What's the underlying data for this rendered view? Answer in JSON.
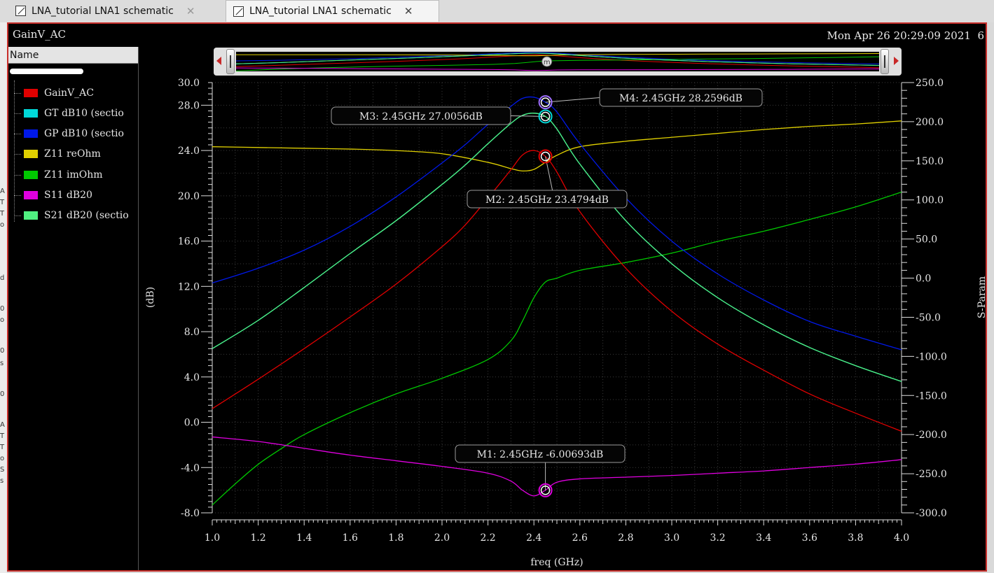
{
  "tabs": [
    {
      "label": "LNA_tutorial LNA1 schematic"
    },
    {
      "label": "LNA_tutorial LNA1 schematic"
    }
  ],
  "window": {
    "plot_title": "GainV_AC",
    "datetime": "Mon Apr 26 20:29:09 2021",
    "subwindow_number": "6"
  },
  "legend": {
    "header": "Name",
    "items": [
      {
        "label": "GainV_AC",
        "color": "#e00000"
      },
      {
        "label": "GT dB10 (sectio",
        "color": "#00d8d8"
      },
      {
        "label": "GP dB10 (sectio",
        "color": "#0018e8"
      },
      {
        "label": "Z11 reOhm",
        "color": "#e0d000"
      },
      {
        "label": "Z11 imOhm",
        "color": "#00c800"
      },
      {
        "label": "S11 dB20",
        "color": "#e000e0"
      },
      {
        "label": "S21 dB20 (sectio",
        "color": "#50f080"
      }
    ]
  },
  "left_edge_glyphs": [
    "A",
    "T",
    "T",
    "o",
    "d",
    "0",
    "o",
    "0",
    "s",
    "0",
    "A",
    "T",
    "T",
    "o",
    "S",
    "s"
  ],
  "overview": {
    "marker_glyph": "m",
    "left_glyph": "ll",
    "right_glyph": "ll"
  },
  "chart_data": {
    "type": "line",
    "xlabel": "freq (GHz)",
    "ylabel_left": "(dB)",
    "ylabel_right": "S-Param",
    "xlim": [
      1.0,
      4.0
    ],
    "ylim_left": [
      -8.0,
      30.0
    ],
    "ylim_right": [
      -300.0,
      250.0
    ],
    "x_ticks": [
      "1.0",
      "1.2",
      "1.4",
      "1.6",
      "1.8",
      "2.0",
      "2.2",
      "2.4",
      "2.6",
      "2.8",
      "3.0",
      "3.2",
      "3.4",
      "3.6",
      "3.8",
      "4.0"
    ],
    "y_ticks_left": [
      "30.0",
      "28.0",
      "24.0",
      "20.0",
      "16.0",
      "12.0",
      "8.0",
      "4.0",
      "0.0",
      "-4.0",
      "-8.0"
    ],
    "y_ticks_right": [
      "250.0",
      "200.0",
      "150.0",
      "100.0",
      "50.0",
      "0.0",
      "-50.0",
      "-100.0",
      "-150.0",
      "-200.0",
      "-250.0",
      "-300.0"
    ],
    "grid": true,
    "series": [
      {
        "name": "GainV_AC",
        "axis": "left",
        "color": "#e00000",
        "x": [
          1.0,
          1.2,
          1.4,
          1.6,
          1.8,
          2.0,
          2.1,
          2.2,
          2.3,
          2.35,
          2.4,
          2.45,
          2.5,
          2.6,
          2.8,
          3.0,
          3.2,
          3.4,
          3.6,
          3.8,
          4.0
        ],
        "y": [
          1.2,
          3.8,
          6.5,
          9.3,
          12.2,
          15.5,
          17.4,
          19.8,
          22.3,
          23.6,
          24.0,
          23.48,
          22.1,
          18.6,
          13.6,
          9.8,
          6.9,
          4.6,
          2.5,
          0.8,
          -0.8
        ]
      },
      {
        "name": "GT dB10 (sectio",
        "axis": "left",
        "color": "#00d8d8",
        "x": [
          1.0,
          1.2,
          1.4,
          1.6,
          1.8,
          2.0,
          2.1,
          2.2,
          2.3,
          2.35,
          2.4,
          2.45,
          2.5,
          2.6,
          2.8,
          3.0,
          3.2,
          3.4,
          3.6,
          3.8,
          4.0
        ],
        "y": [
          6.5,
          9.0,
          11.9,
          14.9,
          17.8,
          21.0,
          22.7,
          24.6,
          26.4,
          27.1,
          27.3,
          27.01,
          25.9,
          22.8,
          17.8,
          14.0,
          11.0,
          8.6,
          6.6,
          5.0,
          3.6
        ]
      },
      {
        "name": "GP dB10 (sectio",
        "axis": "left",
        "color": "#0018e8",
        "x": [
          1.0,
          1.2,
          1.4,
          1.6,
          1.8,
          2.0,
          2.1,
          2.2,
          2.3,
          2.35,
          2.4,
          2.45,
          2.5,
          2.6,
          2.8,
          3.0,
          3.2,
          3.4,
          3.6,
          3.8,
          4.0
        ],
        "y": [
          12.3,
          13.6,
          15.2,
          17.3,
          19.9,
          22.9,
          24.5,
          26.3,
          27.9,
          28.6,
          28.7,
          28.26,
          27.4,
          24.6,
          19.8,
          16.0,
          13.1,
          10.8,
          8.9,
          7.6,
          6.4
        ]
      },
      {
        "name": "Z11 reOhm",
        "axis": "right",
        "color": "#e0d000",
        "x": [
          1.0,
          1.2,
          1.4,
          1.6,
          1.8,
          2.0,
          2.2,
          2.3,
          2.35,
          2.4,
          2.45,
          2.5,
          2.6,
          2.8,
          3.0,
          3.2,
          3.4,
          3.6,
          3.8,
          4.0
        ],
        "y": [
          168,
          167,
          166,
          165,
          163,
          159,
          148,
          140,
          137,
          139,
          148,
          157,
          168,
          175,
          180,
          185,
          190,
          194,
          197,
          201
        ]
      },
      {
        "name": "Z11 imOhm",
        "axis": "right",
        "color": "#00c800",
        "x": [
          1.0,
          1.1,
          1.2,
          1.3,
          1.4,
          1.6,
          1.8,
          2.0,
          2.2,
          2.3,
          2.35,
          2.4,
          2.45,
          2.5,
          2.6,
          2.8,
          3.0,
          3.2,
          3.4,
          3.6,
          3.8,
          4.0
        ],
        "y": [
          -290,
          -263,
          -238,
          -218,
          -200,
          -172,
          -148,
          -128,
          -104,
          -80,
          -55,
          -25,
          -5,
          0,
          10,
          20,
          32,
          47,
          60,
          75,
          91,
          110
        ]
      },
      {
        "name": "S11 dB20",
        "axis": "left",
        "color": "#e000e0",
        "x": [
          1.0,
          1.2,
          1.4,
          1.6,
          1.8,
          2.0,
          2.2,
          2.3,
          2.35,
          2.4,
          2.45,
          2.5,
          2.6,
          2.8,
          3.0,
          3.2,
          3.4,
          3.6,
          3.8,
          4.0
        ],
        "y": [
          -1.3,
          -1.7,
          -2.3,
          -2.9,
          -3.4,
          -3.9,
          -4.5,
          -5.2,
          -6.0,
          -6.5,
          -6.0,
          -5.3,
          -5.0,
          -4.85,
          -4.7,
          -4.5,
          -4.3,
          -4.0,
          -3.7,
          -3.3
        ]
      },
      {
        "name": "S21 dB20 (sectio",
        "axis": "left",
        "color": "#50f080",
        "x": [
          1.0,
          1.2,
          1.4,
          1.6,
          1.8,
          2.0,
          2.1,
          2.2,
          2.3,
          2.35,
          2.4,
          2.45,
          2.5,
          2.6,
          2.8,
          3.0,
          3.2,
          3.4,
          3.6,
          3.8,
          4.0
        ],
        "y": [
          6.5,
          9.0,
          11.9,
          14.9,
          17.8,
          21.0,
          22.7,
          24.6,
          26.4,
          27.1,
          27.3,
          27.01,
          25.9,
          22.8,
          17.8,
          14.0,
          11.0,
          8.6,
          6.6,
          5.0,
          3.6
        ]
      }
    ],
    "markers": [
      {
        "label": "M1: 2.45GHz -6.00693dB",
        "x": 2.45,
        "y": -6.00693,
        "color": "#e000e0"
      },
      {
        "label": "M2: 2.45GHz 23.4794dB",
        "x": 2.45,
        "y": 23.4794,
        "color": "#e00000"
      },
      {
        "label": "M3: 2.45GHz 27.0056dB",
        "x": 2.45,
        "y": 27.0056,
        "color": "#00d8d8"
      },
      {
        "label": "M4: 2.45GHz 28.2596dB",
        "x": 2.45,
        "y": 28.2596,
        "color": "#a070ff"
      }
    ]
  }
}
